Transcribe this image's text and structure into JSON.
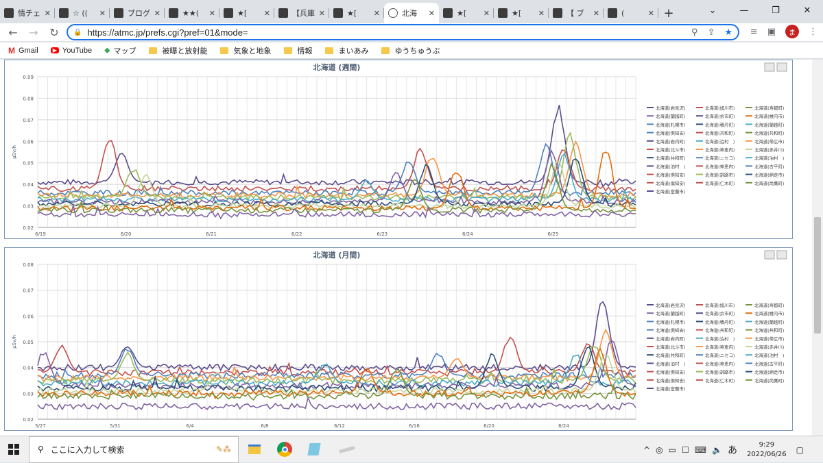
{
  "tabs": [
    {
      "title": "情チェ"
    },
    {
      "title": "☆ (("
    },
    {
      "title": "ブログ"
    },
    {
      "title": "★★("
    },
    {
      "title": "★["
    },
    {
      "title": "【兵庫"
    },
    {
      "title": "★["
    },
    {
      "title": "北海"
    },
    {
      "title": "★["
    },
    {
      "title": "★["
    },
    {
      "title": "【 ブ"
    },
    {
      "title": "("
    }
  ],
  "toolbar": {
    "url": "https://atmc.jp/prefs.cgi?pref=01&mode=",
    "avatar_letter": "ま"
  },
  "bookmarks": [
    {
      "label": "Gmail",
      "icon": "gmail-icon"
    },
    {
      "label": "YouTube",
      "icon": "youtube-icon"
    },
    {
      "label": "マップ",
      "icon": "maps-icon"
    },
    {
      "label": "被曝と放射能",
      "icon": "folder-icon"
    },
    {
      "label": "気象と地象",
      "icon": "folder-icon"
    },
    {
      "label": "情報",
      "icon": "folder-icon"
    },
    {
      "label": "まいあみ",
      "icon": "folder-icon"
    },
    {
      "label": "ゆうちゅうぶ",
      "icon": "folder-icon"
    }
  ],
  "chart_data": [
    {
      "type": "line",
      "title": "北海道 (週間)",
      "ylabel": "μSv/h",
      "ylim": [
        0.02,
        0.09
      ],
      "yticks": [
        "0.09",
        "0.08",
        "0.07",
        "0.06",
        "0.05",
        "0.04",
        "0.03",
        "0.02"
      ],
      "xticks": [
        "6/19",
        "6/20",
        "6/21",
        "6/22",
        "6/23",
        "6/24",
        "6/25"
      ],
      "grid": true,
      "legend_placement": "right",
      "legend": [
        "北海道(岩見沢)",
        "北海道(旭川市)",
        "北海道(寿都町)",
        "北海道(蘭越町)",
        "北海道(余市町)",
        "北海道(帷内市)",
        "北海道(札幌市)",
        "北海道(積丹町)",
        "北海道(蘭越町)",
        "北海道(倶知安)",
        "北海道(共和町)",
        "北海道(共和町)",
        "北海道(岩内町)",
        "北海道(泊村　)",
        "北海道(帯広市)",
        "北海道(北斗市)",
        "北海道(神恵内)",
        "北海道(赤井川)",
        "北海道(共和町)",
        "北海道(ニセコ)",
        "北海道(泊村　)",
        "北海道(泊村　)",
        "北海道(神恵内)",
        "北海道(古平町)",
        "北海道(倶知安)",
        "北海道(釧路市)",
        "北海道(網走市)",
        "北海道(倶知安)",
        "北海道(仁木町)",
        "北海道(尚鷹町)",
        "北海道(室蘭市)"
      ],
      "series": [
        {
          "base": 0.041,
          "color": "#5b4a8c",
          "peaks": [
            [
              0.87,
              0.078
            ],
            [
              0.14,
              0.055
            ]
          ]
        },
        {
          "base": 0.038,
          "color": "#c0504d",
          "peaks": [
            [
              0.12,
              0.063
            ],
            [
              0.64,
              0.058
            ],
            [
              0.88,
              0.058
            ]
          ]
        },
        {
          "base": 0.036,
          "color": "#4f81bd",
          "peaks": [
            [
              0.62,
              0.052
            ],
            [
              0.85,
              0.06
            ]
          ]
        },
        {
          "base": 0.035,
          "color": "#f79646",
          "peaks": [
            [
              0.66,
              0.055
            ],
            [
              0.9,
              0.062
            ]
          ]
        },
        {
          "base": 0.034,
          "color": "#9bbb59",
          "peaks": [
            [
              0.16,
              0.048
            ],
            [
              0.89,
              0.064
            ]
          ]
        },
        {
          "base": 0.033,
          "color": "#4bacc6",
          "peaks": [
            [
              0.55,
              0.042
            ],
            [
              0.88,
              0.055
            ]
          ]
        },
        {
          "base": 0.032,
          "color": "#8064a2",
          "peaks": [
            [
              0.6,
              0.046
            ],
            [
              0.86,
              0.057
            ]
          ]
        },
        {
          "base": 0.031,
          "color": "#2c4d75",
          "peaks": [
            [
              0.65,
              0.05
            ],
            [
              0.9,
              0.055
            ]
          ]
        },
        {
          "base": 0.03,
          "color": "#c3d69b",
          "peaks": [
            [
              0.18,
              0.045
            ],
            [
              0.87,
              0.052
            ]
          ]
        },
        {
          "base": 0.029,
          "color": "#e46c0a",
          "peaks": [
            [
              0.7,
              0.048
            ],
            [
              0.95,
              0.058
            ]
          ]
        },
        {
          "base": 0.028,
          "color": "#77933c",
          "peaks": [
            [
              0.63,
              0.044
            ],
            [
              0.86,
              0.05
            ]
          ]
        },
        {
          "base": 0.026,
          "color": "#8064a2",
          "peaks": []
        }
      ]
    },
    {
      "type": "line",
      "title": "北海道 (月間)",
      "ylabel": "μSv/h",
      "ylim": [
        0.02,
        0.08
      ],
      "yticks": [
        "0.08",
        "0.07",
        "0.06",
        "0.05",
        "0.04",
        "0.03",
        "0.02"
      ],
      "xticks": [
        "5/27",
        "5/31",
        "6/4",
        "6/8",
        "6/12",
        "6/16",
        "6/20",
        "6/24"
      ],
      "grid": true,
      "legend_placement": "right",
      "legend": [
        "北海道(岩見沢)",
        "北海道(旭川市)",
        "北海道(寿都町)",
        "北海道(蘭越町)",
        "北海道(余市町)",
        "北海道(帷内市)",
        "北海道(札幌市)",
        "北海道(積丹町)",
        "北海道(蘭越町)",
        "北海道(倶知安)",
        "北海道(共和町)",
        "北海道(共和町)",
        "北海道(岩内町)",
        "北海道(泊村　)",
        "北海道(帯広市)",
        "北海道(北斗市)",
        "北海道(神恵内)",
        "北海道(赤井川)",
        "北海道(共和町)",
        "北海道(ニセコ)",
        "北海道(泊村　)",
        "北海道(泊村　)",
        "北海道(神恵内)",
        "北海道(古平町)",
        "北海道(倶知安)",
        "北海道(釧路市)",
        "北海道(網走市)",
        "北海道(倶知安)",
        "北海道(仁木町)",
        "北海道(尚鷹町)",
        "北海道(室蘭市)"
      ],
      "series": [
        {
          "base": 0.04,
          "color": "#5b4a8c",
          "peaks": [
            [
              0.945,
              0.068
            ],
            [
              0.15,
              0.049
            ]
          ]
        },
        {
          "base": 0.038,
          "color": "#c0504d",
          "peaks": [
            [
              0.04,
              0.049
            ],
            [
              0.79,
              0.053
            ],
            [
              0.92,
              0.05
            ]
          ]
        },
        {
          "base": 0.037,
          "color": "#4f81bd",
          "peaks": [
            [
              0.15,
              0.048
            ],
            [
              0.67,
              0.046
            ]
          ]
        },
        {
          "base": 0.036,
          "color": "#f79646",
          "peaks": [
            [
              0.95,
              0.055
            ],
            [
              0.7,
              0.044
            ]
          ]
        },
        {
          "base": 0.035,
          "color": "#9bbb59",
          "peaks": [
            [
              0.15,
              0.046
            ],
            [
              0.93,
              0.05
            ]
          ]
        },
        {
          "base": 0.034,
          "color": "#4bacc6",
          "peaks": [
            [
              0.48,
              0.042
            ],
            [
              0.9,
              0.046
            ]
          ]
        },
        {
          "base": 0.033,
          "color": "#8064a2",
          "peaks": [
            [
              0.01,
              0.047
            ],
            [
              0.96,
              0.052
            ]
          ]
        },
        {
          "base": 0.032,
          "color": "#2c4d75",
          "peaks": [
            [
              0.76,
              0.046
            ],
            [
              0.92,
              0.049
            ]
          ]
        },
        {
          "base": 0.031,
          "color": "#c3d69b",
          "peaks": [
            [
              0.3,
              0.038
            ],
            [
              0.95,
              0.047
            ]
          ]
        },
        {
          "base": 0.03,
          "color": "#e46c0a",
          "peaks": [
            [
              0.55,
              0.04
            ],
            [
              0.94,
              0.048
            ]
          ]
        },
        {
          "base": 0.029,
          "color": "#77933c",
          "peaks": [
            [
              0.6,
              0.04
            ]
          ]
        },
        {
          "base": 0.025,
          "color": "#8064a2",
          "peaks": []
        }
      ]
    }
  ],
  "taskbar": {
    "search_placeholder": "ここに入力して検索",
    "time": "9:29",
    "date": "2022/06/26",
    "ime": "あ"
  }
}
